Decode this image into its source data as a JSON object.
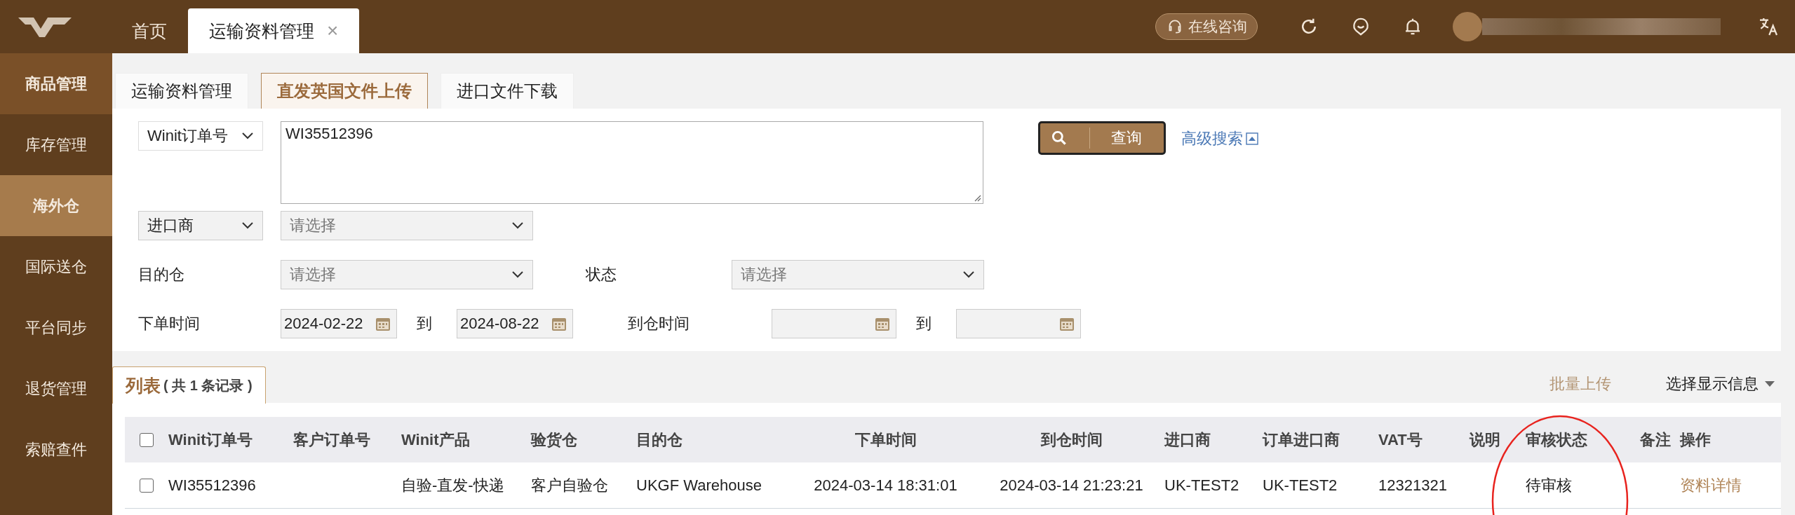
{
  "top_tabs": [
    {
      "label": "首页",
      "selected": false
    },
    {
      "label": "运输资料管理",
      "selected": true,
      "close_glyph": "×"
    }
  ],
  "header": {
    "consult_label": "在线咨询"
  },
  "sidebar": [
    {
      "label": "商品管理",
      "selected": false,
      "hovered": true
    },
    {
      "label": "库存管理",
      "selected": false,
      "hovered": false
    },
    {
      "label": "海外仓",
      "selected": true,
      "hovered": false
    },
    {
      "label": "国际送仓",
      "selected": false,
      "hovered": false
    },
    {
      "label": "平台同步",
      "selected": false,
      "hovered": false
    },
    {
      "label": "退货管理",
      "selected": false,
      "hovered": false
    },
    {
      "label": "索赔查件",
      "selected": false,
      "hovered": false
    }
  ],
  "sub_tabs": [
    {
      "label": "运输资料管理",
      "selected": false
    },
    {
      "label": "直发英国文件上传",
      "selected": true
    },
    {
      "label": "进口文件下载",
      "selected": false
    }
  ],
  "filters": {
    "search_type": "Winit订单号",
    "search_value": "WI35512396",
    "query_button": "查询",
    "advanced_search": "高级搜索",
    "importer_type": "进口商",
    "importer_placeholder": "请选择",
    "destination_label": "目的仓",
    "destination_placeholder": "请选择",
    "status_label": "状态",
    "status_placeholder": "请选择",
    "order_time_label": "下单时间",
    "order_time_from": "2024-02-22",
    "order_time_sep": "到",
    "order_time_to": "2024-08-22",
    "arrival_time_label": "到仓时间",
    "arrival_time_sep": "到"
  },
  "list": {
    "tab_title": "列表",
    "tab_count": "( 共 1 条记录 )",
    "batch_upload": "批量上传",
    "display_options": "选择显示信息"
  },
  "table": {
    "header_checked": false,
    "columns": [
      "Winit订单号",
      "客户订单号",
      "Winit产品",
      "验货仓",
      "目的仓",
      "下单时间",
      "到仓时间",
      "进口商",
      "订单进口商",
      "VAT号",
      "说明",
      "审核状态",
      "备注",
      "操作"
    ],
    "rows": [
      {
        "checked": false,
        "cells": [
          "WI35512396",
          "",
          "自验-直发-快递",
          "客户自验仓",
          "UKGF Warehouse",
          "2024-03-14 18:31:01",
          "2024-03-14 21:23:21",
          "UK-TEST2",
          "UK-TEST2",
          "12321321",
          "",
          "待审核",
          ""
        ],
        "action": "资料详情"
      }
    ]
  },
  "annotation": {
    "color": "#e8231e"
  }
}
